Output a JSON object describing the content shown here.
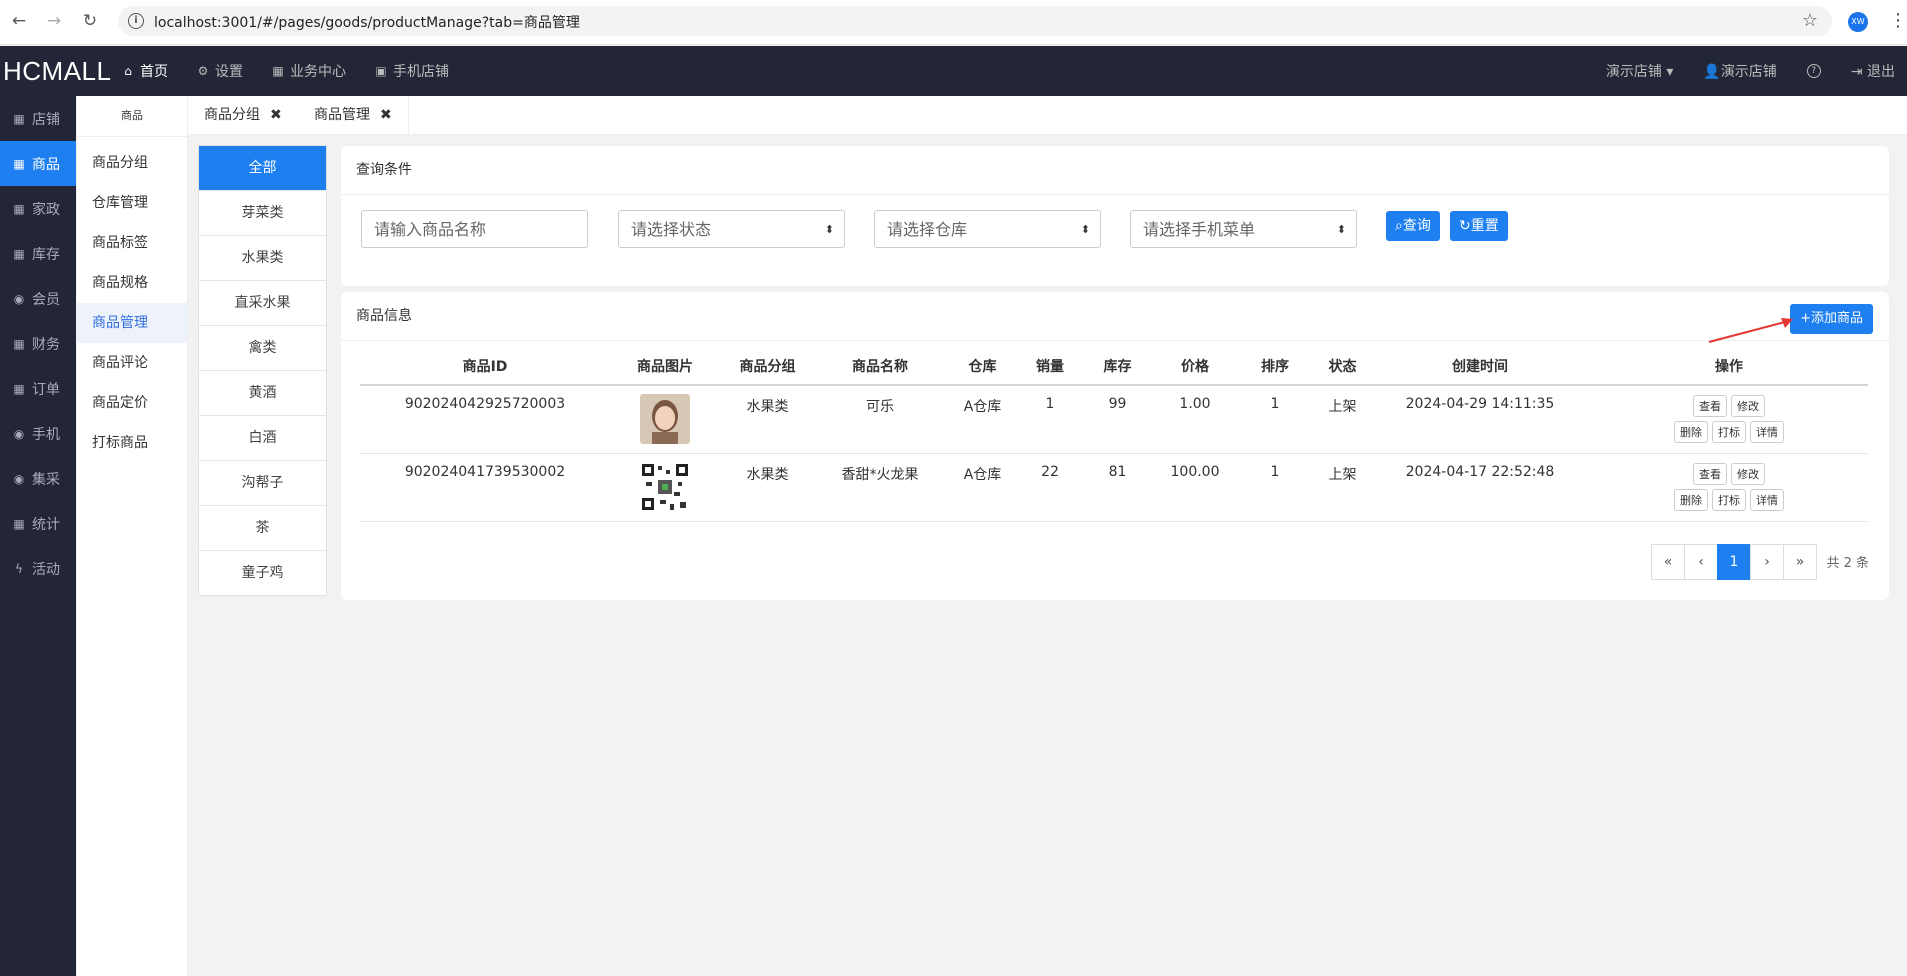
{
  "browser": {
    "url": "localhost:3001/#/pages/goods/productManage?tab=商品管理",
    "profile": "XW"
  },
  "header": {
    "brand": "HCMALL",
    "nav": [
      "首页",
      "设置",
      "业务中心",
      "手机店铺"
    ],
    "right": [
      "演示店铺",
      "演示店铺",
      "?",
      "退出"
    ]
  },
  "sidebar": {
    "items": [
      "店铺",
      "商品",
      "家政",
      "库存",
      "会员",
      "财务",
      "订单",
      "手机",
      "集采",
      "统计",
      "活动"
    ]
  },
  "submenu": {
    "title": "商品",
    "items": [
      "商品分组",
      "仓库管理",
      "商品标签",
      "商品规格",
      "商品管理",
      "商品评论",
      "商品定价",
      "打标商品"
    ]
  },
  "tabs": [
    "商品分组",
    "商品管理"
  ],
  "categories": [
    "全部",
    "芽菜类",
    "水果类",
    "直采水果",
    "禽类",
    "黄酒",
    "白酒",
    "沟帮子",
    "茶",
    "童子鸡"
  ],
  "query": {
    "title": "查询条件",
    "name_placeholder": "请输入商品名称",
    "status_placeholder": "请选择状态",
    "warehouse_placeholder": "请选择仓库",
    "menu_placeholder": "请选择手机菜单",
    "search_label": "查询",
    "reset_label": "重置"
  },
  "info": {
    "title": "商品信息",
    "add_label": "+添加商品",
    "columns": [
      "商品ID",
      "商品图片",
      "商品分组",
      "商品名称",
      "仓库",
      "销量",
      "库存",
      "价格",
      "排序",
      "状态",
      "创建时间",
      "操作"
    ],
    "rows": [
      {
        "id": "902024042925720003",
        "group": "水果类",
        "name": "可乐",
        "warehouse": "A仓库",
        "sales": "1",
        "stock": "99",
        "price": "1.00",
        "sort": "1",
        "status": "上架",
        "created": "2024-04-29 14:11:35"
      },
      {
        "id": "902024041739530002",
        "group": "水果类",
        "name": "香甜*火龙果",
        "warehouse": "A仓库",
        "sales": "22",
        "stock": "81",
        "price": "100.00",
        "sort": "1",
        "status": "上架",
        "created": "2024-04-17 22:52:48"
      }
    ],
    "ops": [
      "查看",
      "修改",
      "删除",
      "打标",
      "详情"
    ],
    "pager": [
      "«",
      "‹",
      "1",
      "›",
      "»"
    ],
    "total": "共 2 条"
  },
  "colors": {
    "accent": "#1e7ff0",
    "dark": "#222636",
    "arrow": "#e53935"
  }
}
